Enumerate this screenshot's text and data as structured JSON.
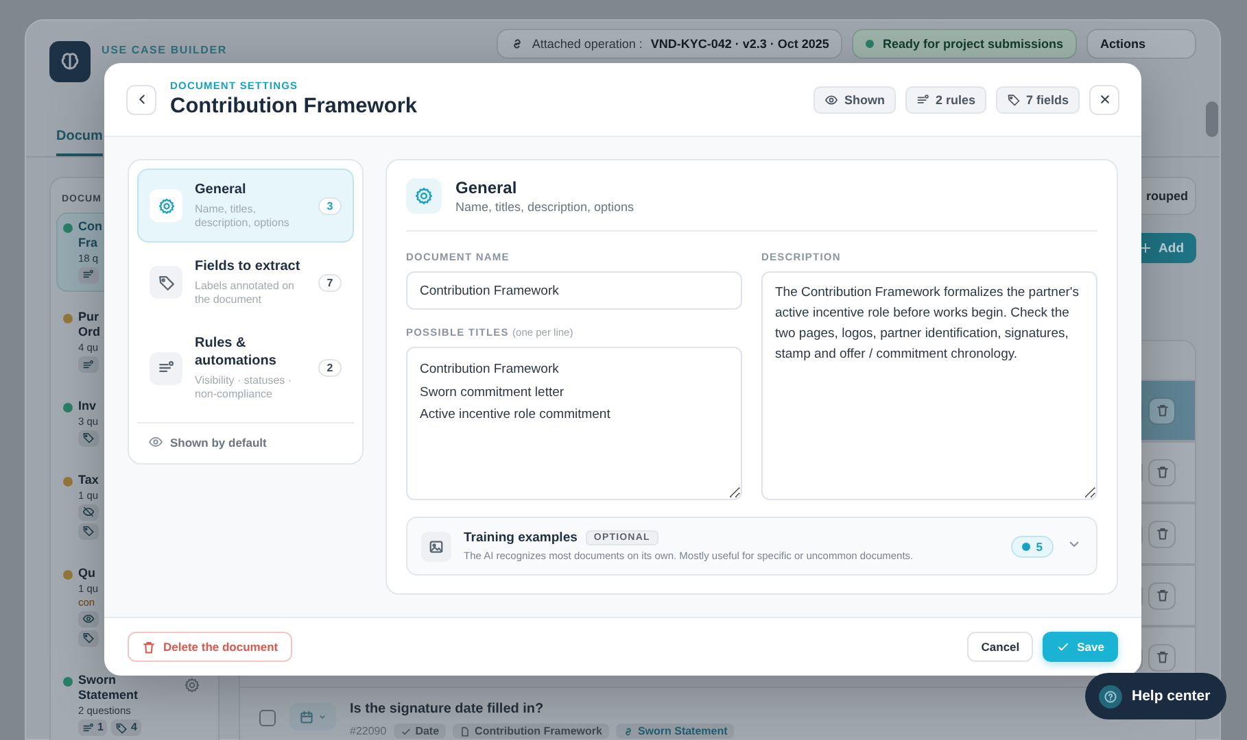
{
  "background": {
    "header": {
      "eyebrow": "USE CASE BUILDER",
      "attached_label": "Attached operation :",
      "attached_value": "VND-KYC-042 · v2.3 · Oct 2025",
      "status": "Ready for project submissions",
      "actions": "Actions"
    },
    "tabs": [
      {
        "label": "Docum",
        "selected": true
      }
    ],
    "sidebar": {
      "heading": "DOCUM",
      "items": [
        {
          "lines": [
            "Con",
            "Fra"
          ],
          "meta": "18 q",
          "color": "#2a7f66",
          "selected": true,
          "chips": [
            {
              "kind": "rules"
            }
          ]
        },
        {
          "lines": [
            "Pur",
            "Ord"
          ],
          "meta": "4 qu",
          "color": "#94773c",
          "selected": false,
          "chips": [
            {
              "kind": "rules"
            }
          ]
        },
        {
          "lines": [
            "Inv"
          ],
          "meta": "3 qu",
          "color": "#2a7f66",
          "selected": false,
          "chips": [
            {
              "kind": "fields"
            }
          ]
        },
        {
          "lines": [
            "Tax"
          ],
          "meta": "1 qu",
          "color": "#94773c",
          "selected": false,
          "chips": [
            {
              "kind": "hidden"
            },
            {
              "kind": "fields"
            }
          ]
        },
        {
          "lines": [
            "Qu"
          ],
          "meta": "1 qu",
          "warning": "con",
          "color": "#94773c",
          "selected": false,
          "chips": [
            {
              "kind": "visibility"
            },
            {
              "kind": "fields"
            }
          ]
        },
        {
          "lines": [
            "Sworn",
            "Statement"
          ],
          "meta": "2 questions",
          "color": "#2a7f66",
          "selected": false,
          "chips": [
            {
              "kind": "rules",
              "count": "1"
            },
            {
              "kind": "fields",
              "count": "4"
            }
          ]
        }
      ]
    },
    "toolbar": {
      "grouping": "rouped",
      "add": "Add"
    },
    "rows": [
      {
        "selected": true
      },
      {
        "selected": false
      },
      {
        "selected": false
      },
      {
        "selected": false
      },
      {
        "selected": false
      }
    ],
    "last_row": {
      "question": "Is the signature date filled in?",
      "number": "#22090",
      "type": "Date",
      "document": "Contribution Framework",
      "link": "Sworn Statement",
      "checked": false
    },
    "help": "Help center"
  },
  "dialog": {
    "eyebrow": "DOCUMENT SETTINGS",
    "title": "Contribution Framework",
    "badges": [
      {
        "kind": "visibility",
        "label": "Shown"
      },
      {
        "kind": "rules",
        "label": "2 rules"
      },
      {
        "kind": "fields",
        "label": "7 fields"
      }
    ],
    "nav": [
      {
        "kind": "general",
        "title": "General",
        "subtitle": "Name, titles, description, options",
        "count": "3",
        "selected": true
      },
      {
        "kind": "fields",
        "title": "Fields to extract",
        "subtitle": "Labels annotated on the document",
        "count": "7",
        "selected": false
      },
      {
        "kind": "rules",
        "title": "Rules & automations",
        "subtitle": "Visibility · statuses · non-compliance",
        "count": "2",
        "selected": false
      }
    ],
    "visibility_note": "Shown by default",
    "section": {
      "title": "General",
      "subtitle": "Name, titles, description, options"
    },
    "document_name": {
      "label": "DOCUMENT NAME",
      "value": "Contribution Framework"
    },
    "possible_titles": {
      "label": "POSSIBLE TITLES",
      "hint": "(one per line)",
      "value": "Contribution Framework\nSworn commitment letter\nActive incentive role commitment"
    },
    "description": {
      "label": "DESCRIPTION",
      "value": "The Contribution Framework formalizes the partner's active incentive role before works begin. Check the two pages, logos, partner identification, signatures, stamp and offer / commitment chronology."
    },
    "training": {
      "title": "Training examples",
      "badge": "OPTIONAL",
      "text": "The AI recognizes most documents on its own. Mostly useful for specific or uncommon documents.",
      "count": "5",
      "expanded": false
    },
    "delete": "Delete the document",
    "cancel": "Cancel",
    "save": "Save"
  }
}
